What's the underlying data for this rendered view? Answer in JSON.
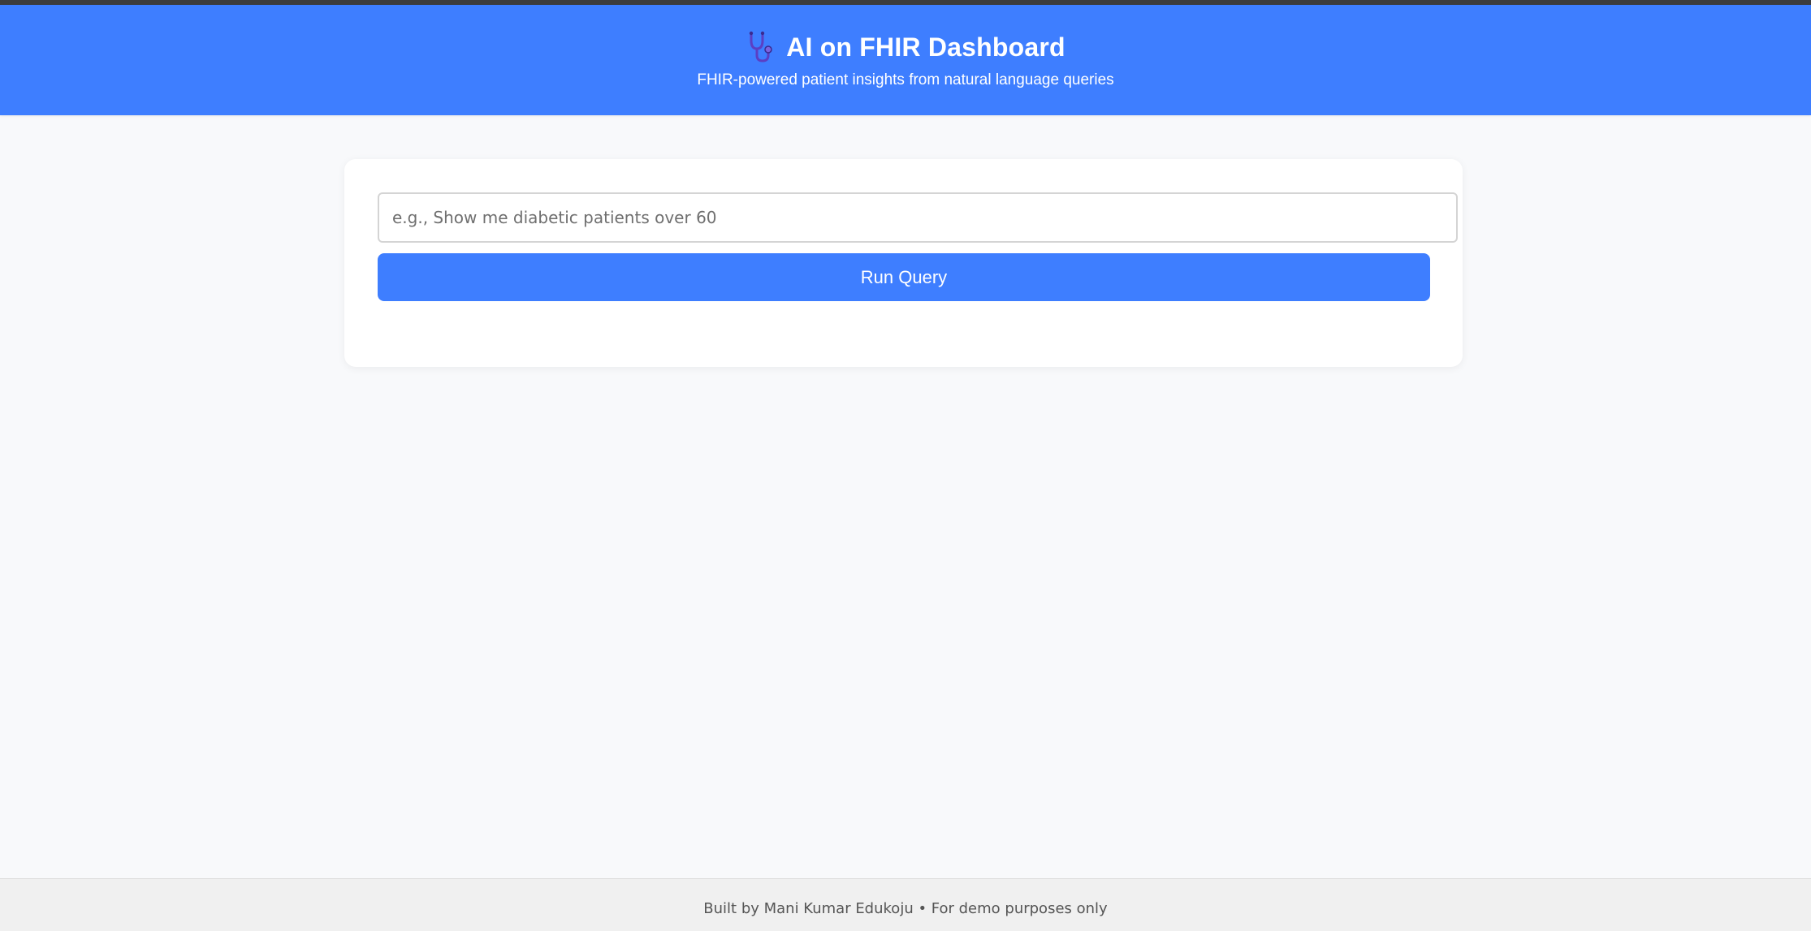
{
  "header": {
    "icon": "stethoscope-icon",
    "title": "AI on FHIR Dashboard",
    "subtitle": "FHIR-powered patient insights from natural language queries",
    "background": "#3e7eff"
  },
  "query": {
    "value": "",
    "placeholder": "e.g., Show me diabetic patients over 60",
    "run_label": "Run Query"
  },
  "footer": {
    "text": "Built by Mani Kumar Edukoju • For demo purposes only"
  },
  "colors": {
    "accent": "#3e7eff",
    "page_background": "#f8f9fb",
    "footer_background": "#f0f0f0"
  }
}
